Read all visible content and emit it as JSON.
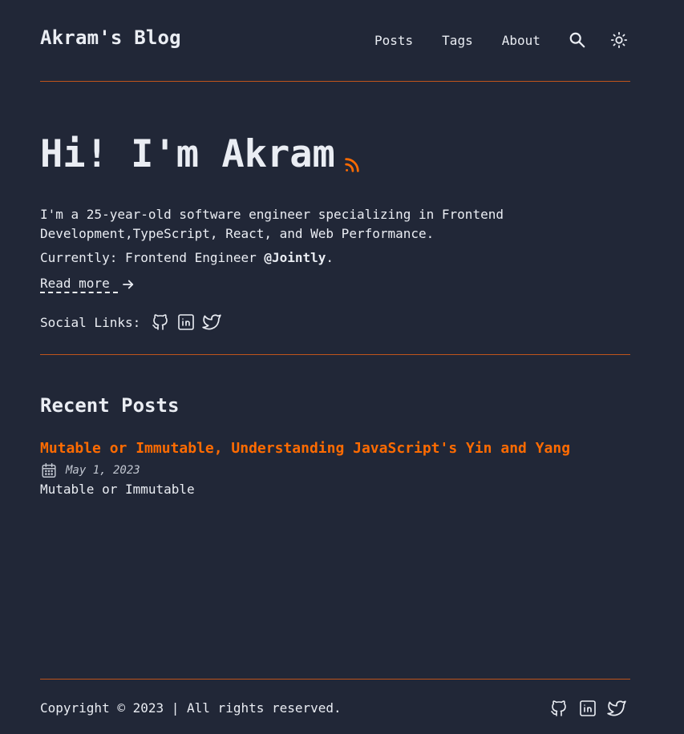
{
  "header": {
    "site_title": "Akram's Blog",
    "nav": [
      {
        "label": "Posts"
      },
      {
        "label": "Tags"
      },
      {
        "label": "About"
      }
    ],
    "search_icon": "search-icon",
    "theme_icon": "sun-icon"
  },
  "hero": {
    "title": "Hi! I'm Akram",
    "rss_icon": "rss-icon",
    "description": "I'm a 25-year-old software engineer specializing in Frontend Development,TypeScript, React, and Web Performance.",
    "current_prefix": "Currently: Frontend Engineer ",
    "current_company": "@Jointly",
    "current_suffix": ".",
    "read_more": "Read more",
    "social_label": "Social Links:",
    "social_icons": [
      "github-icon",
      "linkedin-icon",
      "twitter-icon"
    ]
  },
  "recent": {
    "title": "Recent Posts",
    "posts": [
      {
        "title": "Mutable or Immutable, Understanding JavaScript's Yin and Yang",
        "date": "May 1, 2023",
        "excerpt": "Mutable or Immutable"
      }
    ]
  },
  "footer": {
    "copyright": "Copyright © 2023 | All rights reserved.",
    "social_icons": [
      "github-icon",
      "linkedin-icon",
      "twitter-icon"
    ]
  },
  "colors": {
    "background": "#212737",
    "text": "#eaedf3",
    "accent": "#ff6b01",
    "rule": "#c0541b"
  }
}
